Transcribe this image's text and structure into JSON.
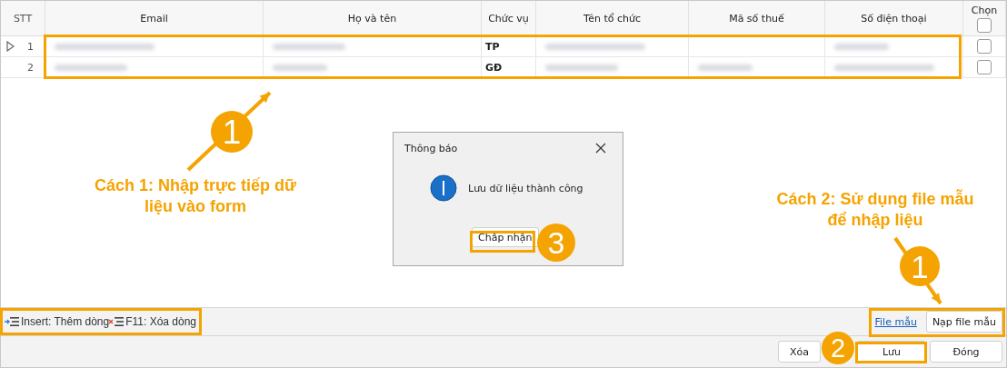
{
  "table": {
    "columns": [
      "STT",
      "Email",
      "Họ và tên",
      "Chức vụ",
      "Tên tổ chức",
      "Mã số thuế",
      "Số điện thoại",
      "Chọn"
    ],
    "header_checkbox": {
      "checked": false
    },
    "rows": [
      {
        "stt": "1",
        "selected": true,
        "cells": [
          {
            "kind": "blurred"
          },
          {
            "kind": "blurred"
          },
          {
            "kind": "text",
            "text": "TP"
          },
          {
            "kind": "blurred"
          },
          {
            "kind": "empty"
          },
          {
            "kind": "blurred"
          }
        ],
        "checked": false
      },
      {
        "stt": "2",
        "selected": false,
        "cells": [
          {
            "kind": "blurred"
          },
          {
            "kind": "blurred"
          },
          {
            "kind": "text",
            "text": "GĐ"
          },
          {
            "kind": "blurred"
          },
          {
            "kind": "blurred"
          },
          {
            "kind": "blurred"
          }
        ],
        "checked": false
      }
    ]
  },
  "toolbar": {
    "hints": [
      {
        "kind": "insert",
        "text": "Insert: Thêm dòng"
      },
      {
        "kind": "delete",
        "text": "F11: Xóa dòng"
      }
    ],
    "link": "File mẫu",
    "import_button": "Nạp file mẫu"
  },
  "buttons": [
    "Xóa",
    "Lưu",
    "Đóng"
  ],
  "dialog": {
    "title": "Thông báo",
    "message": "Lưu dữ liệu thành công",
    "button": "Chấp nhận"
  },
  "annotations": {
    "notes": [
      "Cách 1: Nhập trực tiếp dữ liệu vào form",
      "Cách 2: Sử dụng file mẫu để nhập liệu"
    ],
    "markers": [
      "1",
      "1",
      "2",
      "3"
    ]
  }
}
